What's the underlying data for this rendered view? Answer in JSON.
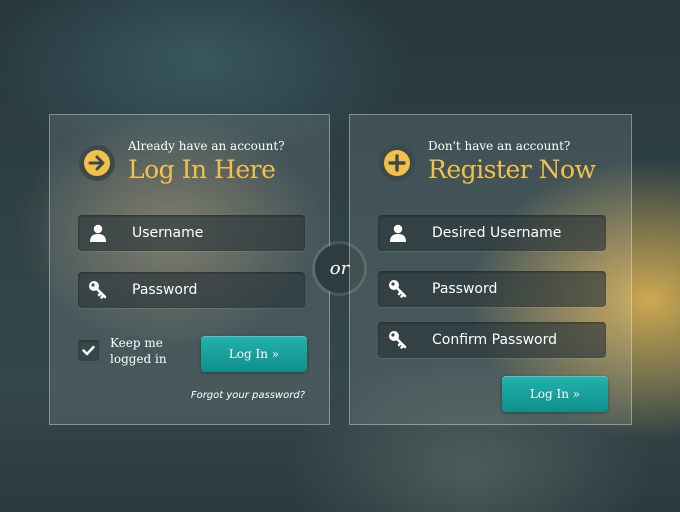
{
  "login": {
    "subtitle": "Already have an account?",
    "title": "Log In Here",
    "username_label": "Username",
    "password_label": "Password",
    "keep_logged_in": "Keep me logged in",
    "keep_checked": true,
    "button_label": "Log In »",
    "forgot_link": "Forgot your password?"
  },
  "divider": {
    "label": "or"
  },
  "register": {
    "subtitle": "Don't have an account?",
    "title": "Register Now",
    "username_label": "Desired Username",
    "password_label": "Password",
    "confirm_label": "Confirm Password",
    "button_label": "Log In »"
  },
  "colors": {
    "accent_yellow": "#f3c04a",
    "button_teal": "#14a09c"
  },
  "icons": {
    "login_header": "arrow-right-circle-icon",
    "register_header": "plus-circle-icon",
    "user": "user-icon",
    "password": "key-icon",
    "checkbox": "check-icon"
  }
}
